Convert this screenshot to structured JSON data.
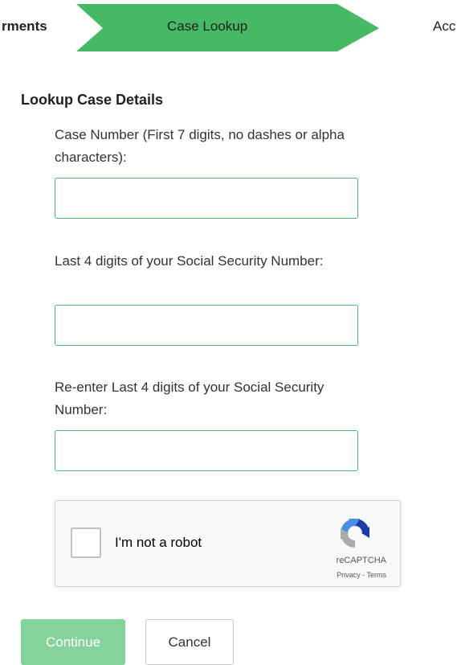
{
  "stepper": {
    "previous_label": "rments",
    "current_label": "Case Lookup",
    "next_label": "Acc",
    "accent_color": "#46b964"
  },
  "form": {
    "title": "Lookup Case Details",
    "case_number": {
      "label": "Case Number (First 7 digits, no dashes or alpha characters):",
      "value": ""
    },
    "ssn_last4": {
      "label": "Last 4 digits of your Social Security Number:",
      "value": ""
    },
    "ssn_last4_confirm": {
      "label": "Re-enter Last 4 digits of your Social Security Number:",
      "value": ""
    }
  },
  "recaptcha": {
    "checkbox_label": "I'm not a robot",
    "brand": "reCAPTCHA",
    "privacy_link": "Privacy",
    "separator": " - ",
    "terms_link": "Terms",
    "logo_icon": "recaptcha-logo-icon"
  },
  "actions": {
    "continue_label": "Continue",
    "cancel_label": "Cancel"
  }
}
